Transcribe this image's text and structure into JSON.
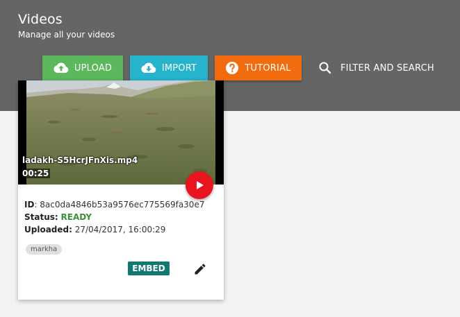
{
  "header": {
    "title": "Videos",
    "subtitle": "Manage all your videos",
    "background": "#656565"
  },
  "toolbar": {
    "upload": {
      "label": "UPLOAD",
      "icon": "cloud-upload-icon",
      "color": "#5cb85c"
    },
    "import": {
      "label": "IMPORT",
      "icon": "cloud-download-icon",
      "color": "#26b3cc"
    },
    "tutorial": {
      "label": "TUTORIAL",
      "icon": "help-circle-icon",
      "color": "#f26b0f"
    },
    "filter": {
      "label": "FILTER AND SEARCH",
      "icon": "search-icon"
    }
  },
  "videos": [
    {
      "filename": "ladakh-S5HcrJFnXis.mp4",
      "duration": "00:25",
      "id_label": "ID",
      "id": "8ac0da4846b53a9576ec775569fa30e7",
      "status_label": "Status:",
      "status": "READY",
      "status_color": "#3b8f3b",
      "uploaded_label": "Uploaded:",
      "uploaded": "27/04/2017, 16:00:29",
      "tags": [
        "markha"
      ],
      "embed_label": "EMBED",
      "play_icon": "play-icon",
      "edit_icon": "pencil-icon"
    }
  ]
}
